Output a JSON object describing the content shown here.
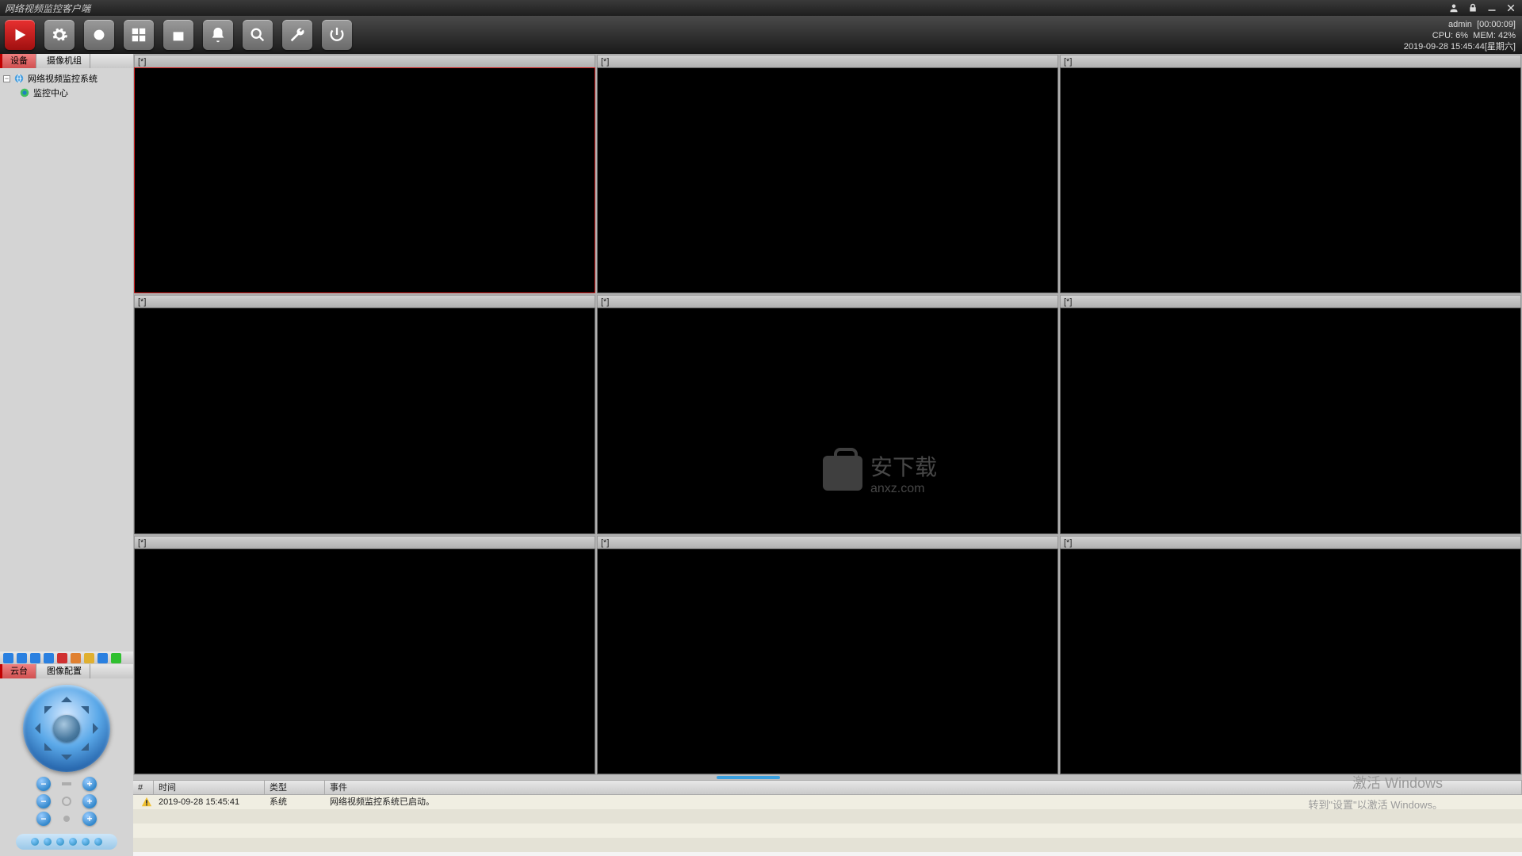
{
  "app": {
    "title": "网络视频监控客户端"
  },
  "titlebar_icons": [
    "user",
    "lock",
    "minimize",
    "close"
  ],
  "status": {
    "user": "admin",
    "uptime": "[00:00:09]",
    "cpu_label": "CPU:",
    "cpu_value": "6%",
    "mem_label": "MEM:",
    "mem_value": "42%",
    "datetime": "2019-09-28 15:45:44[星期六]"
  },
  "toolbar": [
    {
      "name": "play",
      "icon": "play"
    },
    {
      "name": "settings",
      "icon": "gear"
    },
    {
      "name": "record",
      "icon": "circle"
    },
    {
      "name": "layout",
      "icon": "grid"
    },
    {
      "name": "storage",
      "icon": "disk"
    },
    {
      "name": "alarm",
      "icon": "bell"
    },
    {
      "name": "search",
      "icon": "magnifier"
    },
    {
      "name": "tools",
      "icon": "wrench"
    },
    {
      "name": "power",
      "icon": "power"
    }
  ],
  "sidebar": {
    "top_tabs": [
      {
        "label": "设备",
        "active": true
      },
      {
        "label": "摄像机组",
        "active": false
      }
    ],
    "tree": {
      "root": {
        "label": "网络视频监控系统",
        "expanded": true
      },
      "child": {
        "label": "监控中心"
      }
    },
    "mini_toolbar_colors": [
      "#2a80e0",
      "#2a80e0",
      "#2a80e0",
      "#2a80e0",
      "#d03030",
      "#e08030",
      "#e0b030",
      "#2a80e0",
      "#30c030"
    ],
    "bottom_tabs": [
      {
        "label": "云台",
        "active": true
      },
      {
        "label": "图像配置",
        "active": false
      }
    ]
  },
  "video": {
    "cells": [
      "[*]",
      "[*]",
      "[*]",
      "[*]",
      "[*]",
      "[*]",
      "[*]",
      "[*]",
      "[*]"
    ],
    "active_index": 0
  },
  "events": {
    "columns": {
      "idx": "#",
      "time": "时间",
      "type": "类型",
      "event": "事件"
    },
    "rows": [
      {
        "icon": "warn",
        "time": "2019-09-28 15:45:41",
        "type": "系统",
        "event": "网络视频监控系统已启动。"
      }
    ],
    "blank_rows": 3
  },
  "watermark": {
    "line1": "激活 Windows",
    "line2": "转到\"设置\"以激活 Windows。"
  },
  "center_logo_text": "安下载",
  "center_logo_sub": "anxz.com"
}
